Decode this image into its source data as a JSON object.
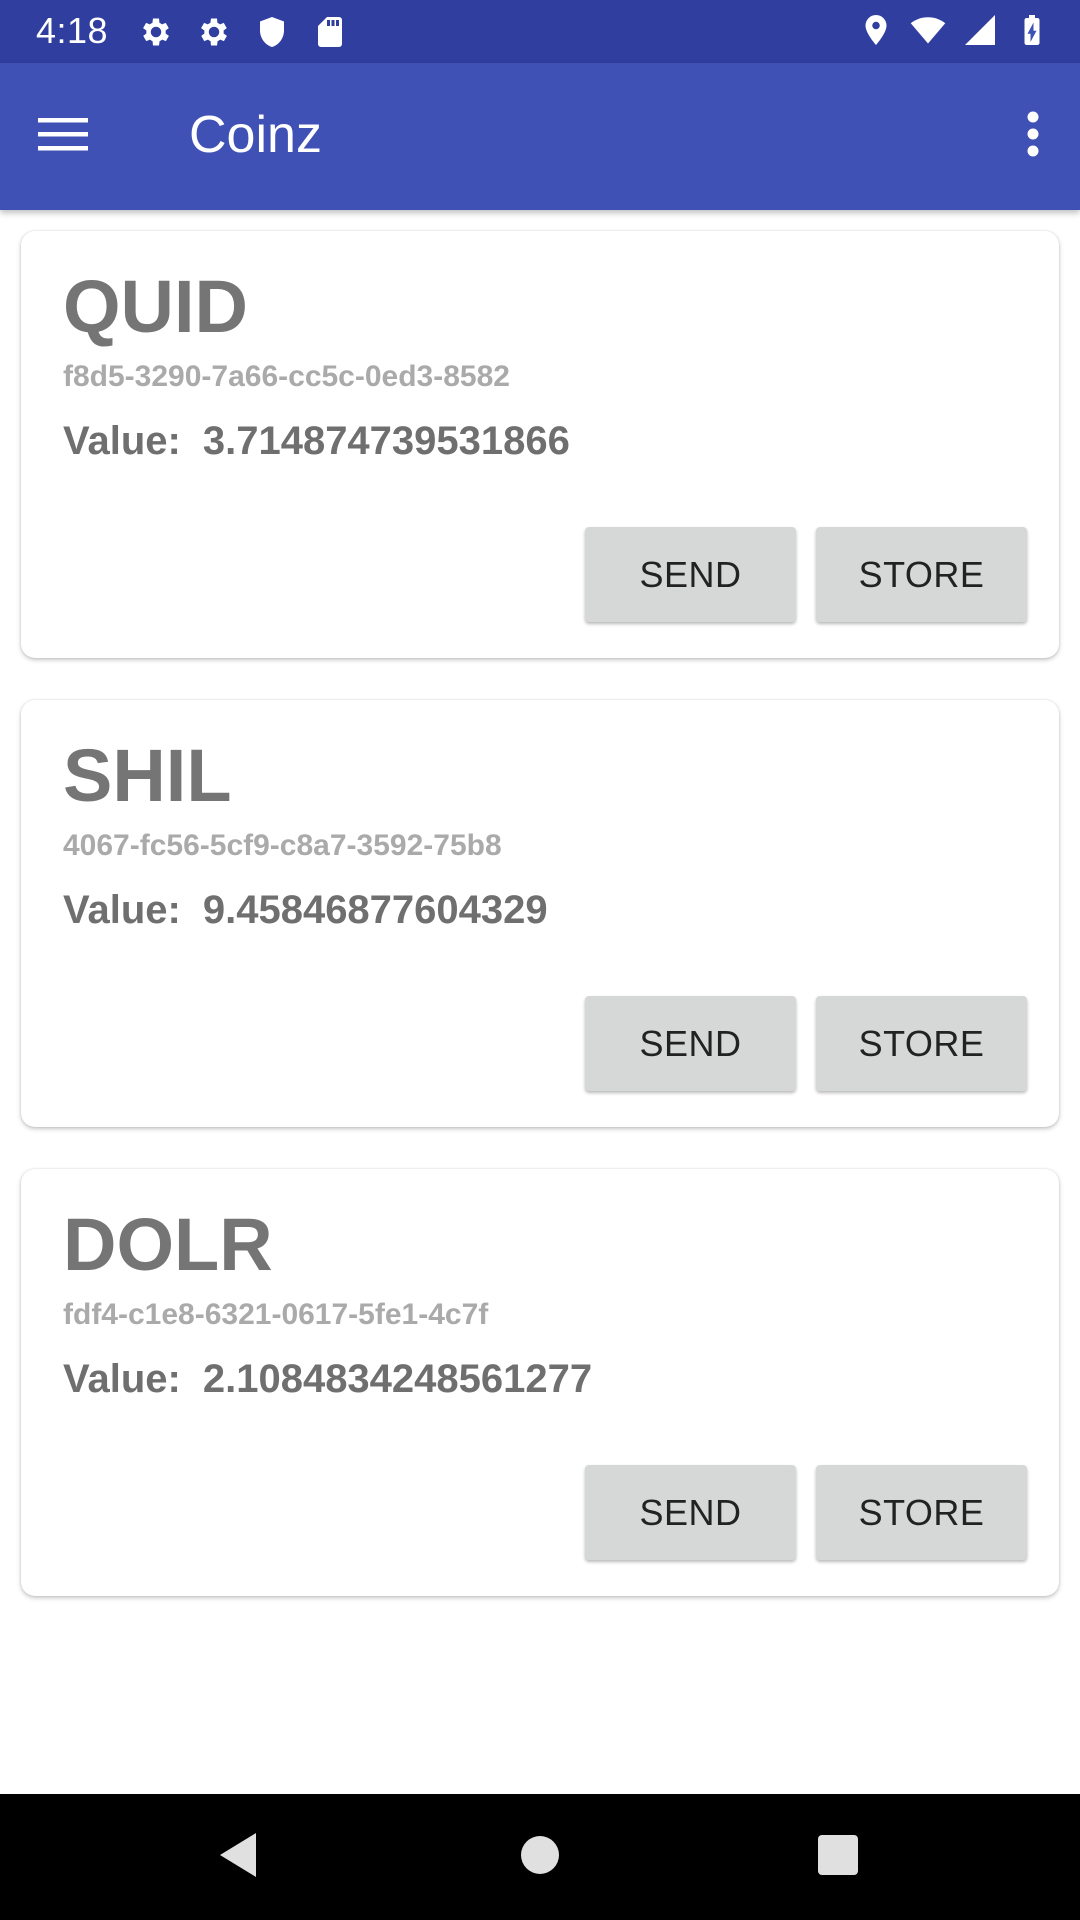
{
  "status_bar": {
    "time": "4:18",
    "left_icons": [
      "gear-icon",
      "gear-icon",
      "shield-icon",
      "sd-card-icon"
    ],
    "right_icons": [
      "location-icon",
      "wifi-icon",
      "signal-icon",
      "battery-icon"
    ]
  },
  "app_bar": {
    "title": "Coinz",
    "menu_icon": "hamburger-icon",
    "overflow_icon": "more-vert-icon"
  },
  "coins": [
    {
      "name": "QUID",
      "id": "f8d5-3290-7a66-cc5c-0ed3-8582",
      "value_label": "Value:",
      "value": "3.714874739531866",
      "send_label": "SEND",
      "store_label": "STORE"
    },
    {
      "name": "SHIL",
      "id": "4067-fc56-5cf9-c8a7-3592-75b8",
      "value_label": "Value:",
      "value": "9.45846877604329",
      "send_label": "SEND",
      "store_label": "STORE"
    },
    {
      "name": "DOLR",
      "id": "fdf4-c1e8-6321-0617-5fe1-4c7f",
      "value_label": "Value:",
      "value": "2.1084834248561277",
      "send_label": "SEND",
      "store_label": "STORE"
    }
  ],
  "nav_bar": {
    "icons": [
      "back-icon",
      "home-icon",
      "recents-icon"
    ]
  },
  "colors": {
    "status_bar": "#303f9f",
    "app_bar": "#3f51b5",
    "button": "#d6d7d7",
    "coin_name": "#757575",
    "coin_id": "#aaaaaa"
  }
}
